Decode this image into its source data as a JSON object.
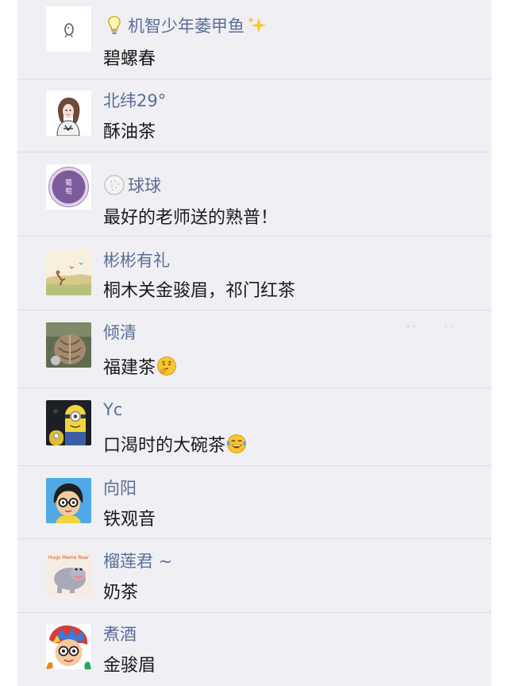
{
  "comments": [
    {
      "name": "机智少年萎甲鱼",
      "message": "碧螺春",
      "avatar_icon": "small-figure-avatar",
      "name_prefix_icon": "lightbulb-icon",
      "name_suffix_icon": "sparkles-icon"
    },
    {
      "name": "北纬29°",
      "message": "酥油茶",
      "avatar_icon": "girl-cartoon-avatar"
    },
    {
      "name": "球球",
      "message": "最好的老师送的熟普！",
      "avatar_icon": "purple-seal-avatar",
      "avatar_text": "葡萄",
      "name_prefix_icon": "golf-ball-icon"
    },
    {
      "name": "彬彬有礼",
      "message": "桐木关金骏眉，祁门红茶",
      "avatar_icon": "field-painting-avatar"
    },
    {
      "name": "倾清",
      "message": "福建茶",
      "avatar_icon": "braided-hair-avatar",
      "message_suffix_icon": "thinking-face-emoji"
    },
    {
      "name": "Yc",
      "message": "口渴时的大碗茶",
      "avatar_icon": "minion-avatar",
      "message_suffix_icon": "tears-of-joy-emoji"
    },
    {
      "name": "向阳",
      "message": "铁观音",
      "avatar_icon": "glasses-boy-avatar"
    },
    {
      "name": "榴莲君 ~",
      "message": "奶茶",
      "avatar_icon": "hippo-book-avatar",
      "avatar_text": "Hugs, Meme, Roar"
    },
    {
      "name": "煮酒",
      "message": "金骏眉",
      "avatar_icon": "colorful-kid-avatar"
    }
  ],
  "colors": {
    "name": "#5c6e95",
    "message": "#1a1a1a",
    "background": "#efeff4",
    "divider": "#dcdce0"
  }
}
